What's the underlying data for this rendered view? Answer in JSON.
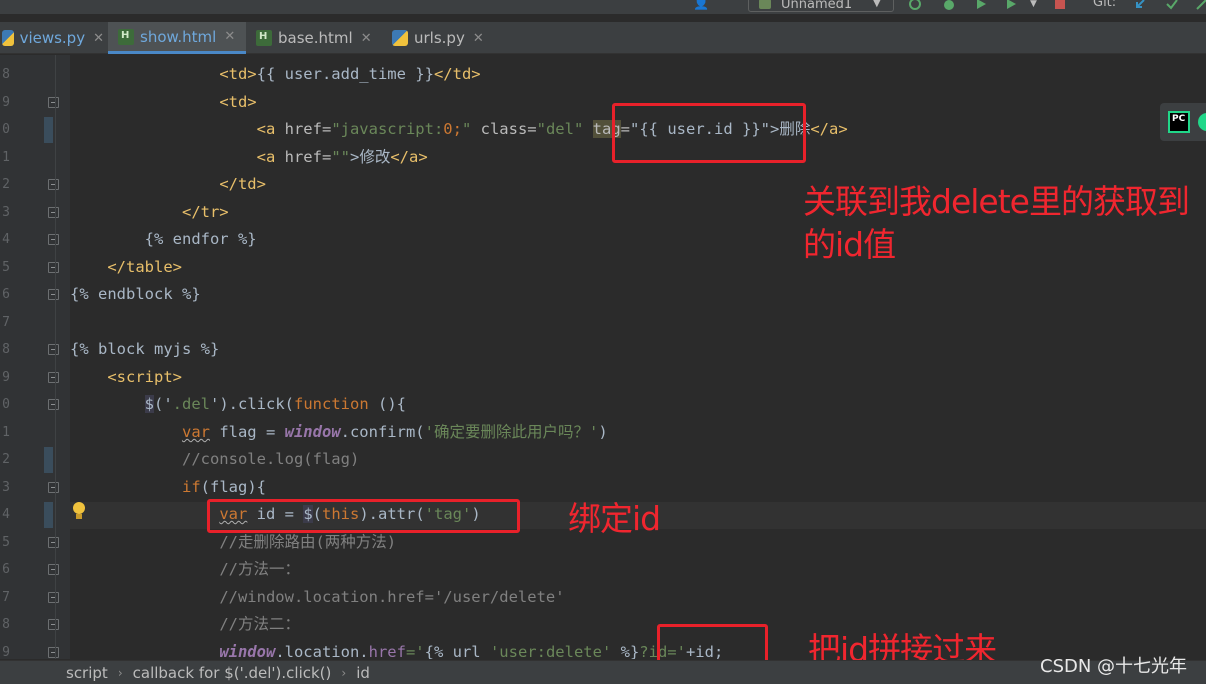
{
  "toolbar": {
    "run_config": "Unnamed1",
    "git_label": "Git:"
  },
  "tabs": [
    {
      "label": "views.py",
      "icon": "python-file-icon",
      "active": false
    },
    {
      "label": "show.html",
      "icon": "html-file-icon",
      "active": true
    },
    {
      "label": "base.html",
      "icon": "html-file-icon",
      "active": false
    },
    {
      "label": "urls.py",
      "icon": "python-file-icon",
      "active": false
    }
  ],
  "line_numbers": [
    "8",
    "9",
    "0",
    "1",
    "2",
    "3",
    "4",
    "5",
    "6",
    "7",
    "8",
    "9",
    "0",
    "1",
    "2",
    "3",
    "4",
    "5",
    "6",
    "7",
    "8",
    "9"
  ],
  "code": {
    "l1": {
      "indent": "                ",
      "p1": "<td>",
      "p2": "{{ user.add_time }}",
      "p3": "</td>"
    },
    "l2": {
      "indent": "                ",
      "p1": "<td>"
    },
    "l3": {
      "indent": "                    ",
      "p1": "<a ",
      "p2": "href=",
      "p3": "\"javascript:",
      "p4": "0;",
      "p5": "\"",
      "p6": " class=",
      "p7": "\"del\"",
      "p8": " ",
      "p9": "tag",
      "p10": "=",
      "p11": "\"{{ user.id }}\"",
      "p12": ">删除",
      "p13": "</a>"
    },
    "l4": {
      "indent": "                    ",
      "p1": "<a ",
      "p2": "href=",
      "p3": "\"\"",
      "p4": ">修改",
      "p5": "</a>"
    },
    "l5": {
      "indent": "                ",
      "p1": "</td>"
    },
    "l6": {
      "indent": "            ",
      "p1": "</tr>"
    },
    "l7": {
      "indent": "        ",
      "p1": "{% endfor %}"
    },
    "l8": {
      "indent": "    ",
      "p1": "</table>"
    },
    "l9": {
      "indent": "",
      "p1": "{% endblock %}"
    },
    "l10": {
      "indent": "",
      "p1": ""
    },
    "l11": {
      "indent": "",
      "p1": "{% block myjs %}"
    },
    "l12": {
      "indent": "    ",
      "p1": "<script>"
    },
    "l13": {
      "indent": "        ",
      "p1": "$",
      "p2": "('",
      "p3": ".del",
      "p4": "').",
      "p5": "click",
      "p6": "(",
      "p7": "function",
      "p8": " (){"
    },
    "l14": {
      "indent": "            ",
      "p1": "var",
      "p2": " flag = ",
      "p3": "window",
      "p4": ".confirm(",
      "p5": "'确定要删除此用户吗？'",
      "p6": ")"
    },
    "l15": {
      "indent": "            ",
      "p1": "//console.log(flag)"
    },
    "l16": {
      "indent": "            ",
      "p1": "if",
      "p2": "(flag){"
    },
    "l17": {
      "indent": "                ",
      "p1": "var",
      "p2": " id = ",
      "p3": "$",
      "p4": "(",
      "p5": "this",
      "p6": ").attr(",
      "p7": "'tag'",
      "p8": ")"
    },
    "l18": {
      "indent": "                ",
      "p1": "//走删除路由(两种方法)"
    },
    "l19": {
      "indent": "                ",
      "p1": "//方法一："
    },
    "l20": {
      "indent": "                ",
      "p1": "//window.location.href='/user/delete'"
    },
    "l21": {
      "indent": "                ",
      "p1": "//方法二："
    },
    "l22": {
      "indent": "                ",
      "p1": "window",
      "p2": ".location.",
      "p3": "href",
      "p4": "='",
      "p5": "{% url ",
      "p6": "'user:delete'",
      "p7": " %}",
      "p8": "?id='",
      "p9": "+id;"
    }
  },
  "annotations": {
    "note1_line1": "关联到我delete里的获取到",
    "note1_line2": "的id值",
    "note2": "绑定id",
    "note3": "把id拼接过来"
  },
  "breadcrumb": [
    "script",
    "callback for $('.del').click()",
    "id"
  ],
  "watermark": "CSDN @十七光年",
  "colors": {
    "background": "#2b2b2b",
    "annotation_red": "#e8212a",
    "tab_active_underline": "#4a88c7"
  }
}
